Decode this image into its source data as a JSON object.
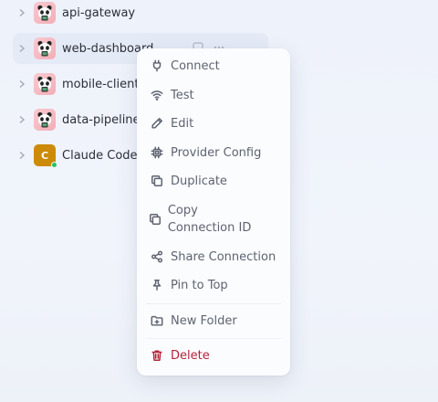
{
  "tree": {
    "rows": [
      {
        "label": "api-gateway"
      },
      {
        "label": "web-dashboard"
      },
      {
        "label": "mobile-client"
      },
      {
        "label": "data-pipeline"
      },
      {
        "label": "Claude Code ·",
        "avatar_letter": "C"
      }
    ]
  },
  "context_menu": {
    "items": [
      {
        "label": "Connect",
        "icon": "plug-icon"
      },
      {
        "label": "Test",
        "icon": "wifi-icon"
      },
      {
        "label": "Edit",
        "icon": "pencil-icon"
      },
      {
        "label": "Provider Config",
        "icon": "chip-icon"
      },
      {
        "label": "Duplicate",
        "icon": "copy-icon"
      },
      {
        "label": "Copy Connection ID",
        "icon": "copy-icon"
      },
      {
        "label": "Share Connection",
        "icon": "share-icon"
      },
      {
        "label": "Pin to Top",
        "icon": "pin-icon"
      },
      {
        "label": "New Folder",
        "icon": "folder-plus-icon"
      },
      {
        "label": "Delete",
        "icon": "trash-icon"
      }
    ]
  },
  "colors": {
    "danger": "#b4233a",
    "status_online": "#22c55e",
    "claude_avatar": "#cc8a08"
  }
}
